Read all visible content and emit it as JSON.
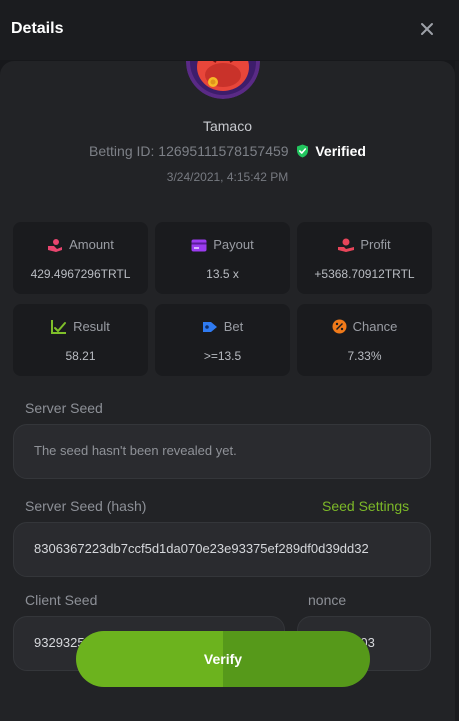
{
  "header": {
    "title": "Details",
    "close_icon": "close-icon"
  },
  "user": {
    "name": "Tamaco",
    "avatar_icon": "monster-avatar"
  },
  "bet": {
    "id_label": "Betting ID: 12695111578157459",
    "verified_label": "Verified",
    "date": "3/24/2021, 4:15:42 PM"
  },
  "stats": [
    {
      "label": "Amount",
      "value": "429.4967296TRTL",
      "icon": "coins-hand-icon",
      "color": "#e8456f"
    },
    {
      "label": "Payout",
      "value": "13.5 x",
      "icon": "card-icon",
      "color": "#9b3bf0"
    },
    {
      "label": "Profit",
      "value": "+5368.70912TRTL",
      "icon": "hand-money-icon",
      "color": "#e8455a"
    },
    {
      "label": "Result",
      "value": "58.21",
      "icon": "chart-check-icon",
      "color": "#7fbf2a"
    },
    {
      "label": "Bet",
      "value": ">=13.5",
      "icon": "tag-icon",
      "color": "#2f7bf2"
    },
    {
      "label": "Chance",
      "value": "7.33%",
      "icon": "percent-icon",
      "color": "#f07a1a"
    }
  ],
  "server_seed": {
    "label": "Server Seed",
    "value": "The seed hasn't been revealed yet."
  },
  "server_seed_hash": {
    "label": "Server Seed (hash)",
    "link": "Seed Settings",
    "value": "8306367223db7ccf5d1da070e23e93375ef289df0d39dd32"
  },
  "client_seed": {
    "label": "Client Seed",
    "value": "932932520cb4aa3e2bfd84d4c1d2a"
  },
  "nonce": {
    "label": "nonce",
    "value": "403"
  },
  "verify_button": {
    "label": "Verify"
  },
  "colors": {
    "accent": "#7cb828",
    "verified": "#22c55e"
  }
}
